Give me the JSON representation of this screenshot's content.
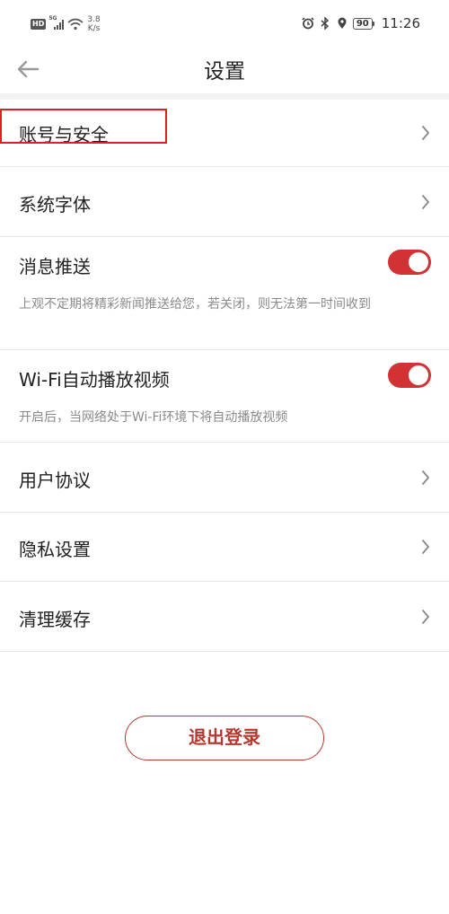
{
  "status_bar": {
    "hd_badge": "HD",
    "network_type": "5G",
    "net_speed_value": "3.8",
    "net_speed_unit": "K/s",
    "battery_level": "90",
    "time": "11:26",
    "icons": [
      "signal-icon",
      "wifi-icon",
      "alarm-icon",
      "bluetooth-icon",
      "location-icon",
      "battery-icon"
    ]
  },
  "header": {
    "title": "设置",
    "back_icon": "back-arrow-icon"
  },
  "settings": {
    "account_security": "账号与安全",
    "system_font": "系统字体",
    "message_push": {
      "label": "消息推送",
      "enabled": true,
      "description": "上观不定期将精彩新闻推送给您，若关闭，则无法第一时间收到"
    },
    "wifi_autoplay": {
      "label": "Wi-Fi自动播放视频",
      "enabled": true,
      "description": "开启后，当网络处于Wi-Fi环境下将自动播放视频"
    },
    "user_agreement": "用户协议",
    "privacy_settings": "隐私设置",
    "clear_cache": "清理缓存"
  },
  "logout_label": "退出登录",
  "colors": {
    "accent": "#d33234",
    "logout": "#b5382f",
    "highlight": "#e02020"
  }
}
